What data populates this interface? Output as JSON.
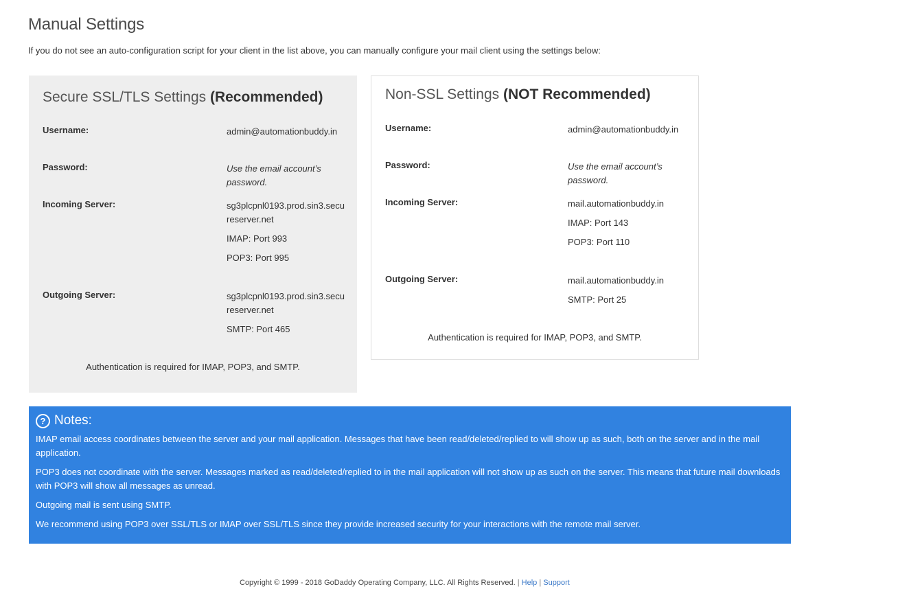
{
  "page": {
    "title": "Manual Settings",
    "intro": "If you do not see an auto-configuration script for your client in the list above, you can manually configure your mail client using the settings below:"
  },
  "ssl": {
    "title_light": "Secure SSL/TLS Settings ",
    "title_bold": "(Recommended)",
    "username_label": "Username:",
    "username_value": "admin@automationbuddy.in",
    "password_label": "Password:",
    "password_value": "Use the email account’s password.",
    "incoming_label": "Incoming Server:",
    "incoming_host": "sg3plcpnl0193.prod.sin3.secureserver.net",
    "imap_port": "IMAP: Port 993",
    "pop3_port": "POP3: Port 995",
    "outgoing_label": "Outgoing Server:",
    "outgoing_host": "sg3plcpnl0193.prod.sin3.secureserver.net",
    "smtp_port": "SMTP: Port 465",
    "auth_note": "Authentication is required for IMAP, POP3, and SMTP."
  },
  "nonssl": {
    "title_light": "Non-SSL Settings ",
    "title_bold": "(NOT Recommended)",
    "username_label": "Username:",
    "username_value": "admin@automationbuddy.in",
    "password_label": "Password:",
    "password_value": "Use the email account’s password.",
    "incoming_label": "Incoming Server:",
    "incoming_host": "mail.automationbuddy.in",
    "imap_port": "IMAP: Port 143",
    "pop3_port": "POP3: Port 110",
    "outgoing_label": "Outgoing Server:",
    "outgoing_host": "mail.automationbuddy.in",
    "smtp_port": "SMTP: Port 25",
    "auth_note": "Authentication is required for IMAP, POP3, and SMTP."
  },
  "notes": {
    "title": "Notes:",
    "icon": "question-circle-icon",
    "items": [
      "IMAP email access coordinates between the server and your mail application. Messages that have been read/deleted/replied to will show up as such, both on the server and in the mail application.",
      "POP3 does not coordinate with the server. Messages marked as read/deleted/replied to in the mail application will not show up as such on the server. This means that future mail downloads with POP3 will show all messages as unread.",
      "Outgoing mail is sent using SMTP.",
      "We recommend using POP3 over SSL/TLS or IMAP over SSL/TLS since they provide increased security for your interactions with the remote mail server."
    ]
  },
  "footer": {
    "copyright": "Copyright © 1999 - 2018 GoDaddy Operating Company, LLC. All Rights Reserved.",
    "separator": "|",
    "help_link": "Help",
    "support_link": "Support"
  },
  "colors": {
    "notes_bg": "#3182e0",
    "ssl_panel_bg": "#eeeeee",
    "link": "#3b79c8"
  }
}
